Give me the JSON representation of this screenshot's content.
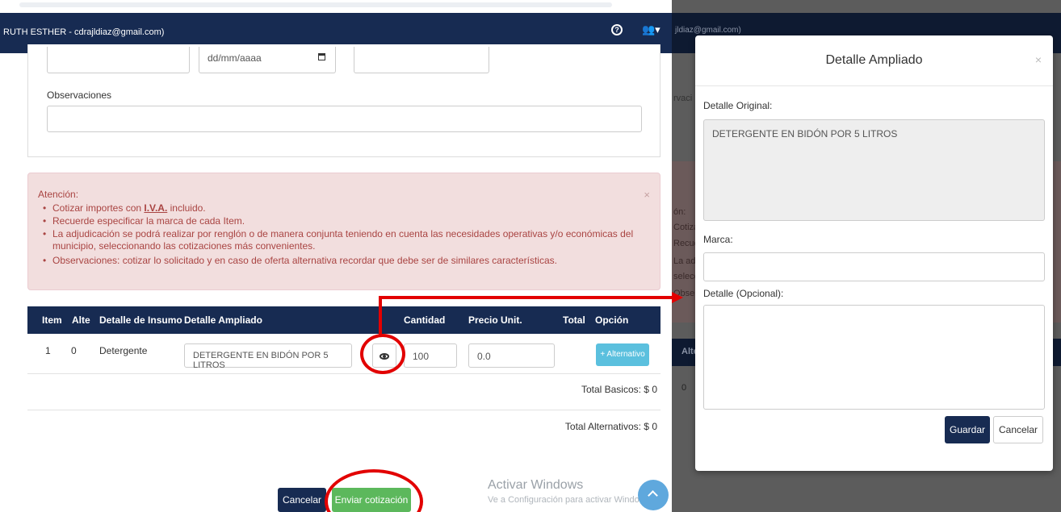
{
  "left": {
    "navbar": {
      "user": "RUTH ESTHER - cdrajldiaz@gmail.com)",
      "help_icon": "question-circle-icon",
      "users_icon": "users-icon"
    },
    "form": {
      "date_placeholder": "dd/mm/aaaa",
      "observaciones_label": "Observaciones",
      "observaciones_value": ""
    },
    "alert": {
      "title": "Atención:",
      "close": "×",
      "items": [
        {
          "prefix": "Cotizar importes con ",
          "bold": "I.V.A.",
          "suffix": " incluido."
        },
        {
          "text": "Recuerde especificar la marca de cada Item."
        },
        {
          "text": "La adjudicación se podrá realizar por renglón o de manera conjunta teniendo en cuenta las necesidades operativas y/o económicas del municipio, seleccionando las cotizaciones más convenientes."
        },
        {
          "text": "Observaciones: cotizar lo solicitado y en caso de oferta alternativa recordar que debe ser de similares características."
        }
      ]
    },
    "table": {
      "headers": [
        "Item",
        "Alte",
        "Detalle de Insumo",
        "Detalle Ampliado",
        "Cantidad",
        "Precio Unit.",
        "Total",
        "Opción"
      ],
      "rows": [
        {
          "item": "1",
          "alte": "0",
          "insumo": "Detergente",
          "ampliado": "DETERGENTE EN BIDÓN POR 5 LITROS",
          "cantidad": "100",
          "precio": "0.0",
          "opcion": "+ Alternativo"
        }
      ]
    },
    "totals": {
      "basicos": "Total Basicos: $ 0",
      "alternativos": "Total Alternativos: $ 0"
    },
    "buttons": {
      "cancelar": "Cancelar",
      "enviar": "Enviar cotización"
    },
    "windows": {
      "line1": "Activar Windows",
      "line2": "Ve a Configuración para activar Windows."
    }
  },
  "right": {
    "bg": {
      "nav_email": "jldiaz@gmail.com)",
      "obs_frag": "rvaci",
      "alert_frags": [
        "ón:",
        "Cotiza",
        "Recue",
        "La adj",
        "selecc",
        "Obser"
      ],
      "thead_frag": "Alte",
      "row_frag": "0"
    },
    "modal": {
      "title": "Detalle Ampliado",
      "close": "×",
      "original_label": "Detalle Original:",
      "original_value": "DETERGENTE EN BIDÓN POR 5 LITROS",
      "marca_label": "Marca:",
      "marca_value": "",
      "detalle_label": "Detalle (Opcional):",
      "detalle_value": "",
      "guardar": "Guardar",
      "cancelar": "Cancelar"
    }
  },
  "colors": {
    "navy": "#172b52",
    "alert_bg": "#f2dede",
    "alert_text": "#a94442",
    "info": "#5bc0de",
    "success": "#5cb85c",
    "annotation": "#e20000"
  }
}
